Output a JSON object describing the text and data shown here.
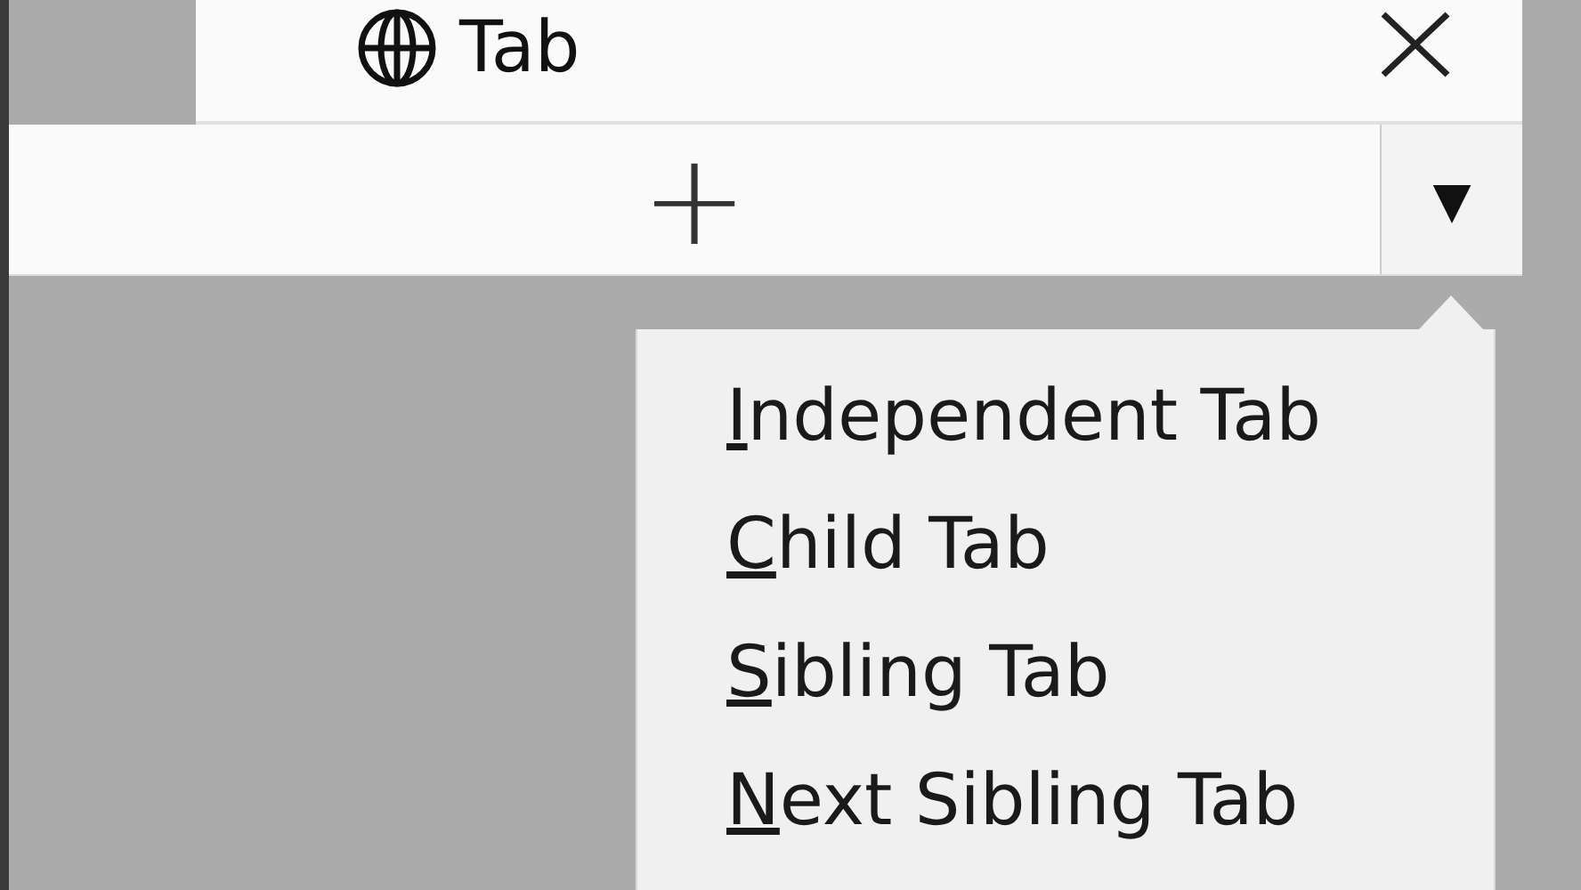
{
  "tab": {
    "title": "Tab"
  },
  "new_tab_bar": {
    "add_label": "+",
    "dropdown_label": "▼"
  },
  "menu": {
    "items": [
      {
        "mnemonic": "I",
        "rest": "ndependent Tab"
      },
      {
        "mnemonic": "C",
        "rest": "hild Tab"
      },
      {
        "mnemonic": "S",
        "rest": "ibling Tab"
      },
      {
        "mnemonic": "N",
        "rest": "ext Sibling Tab"
      }
    ]
  }
}
